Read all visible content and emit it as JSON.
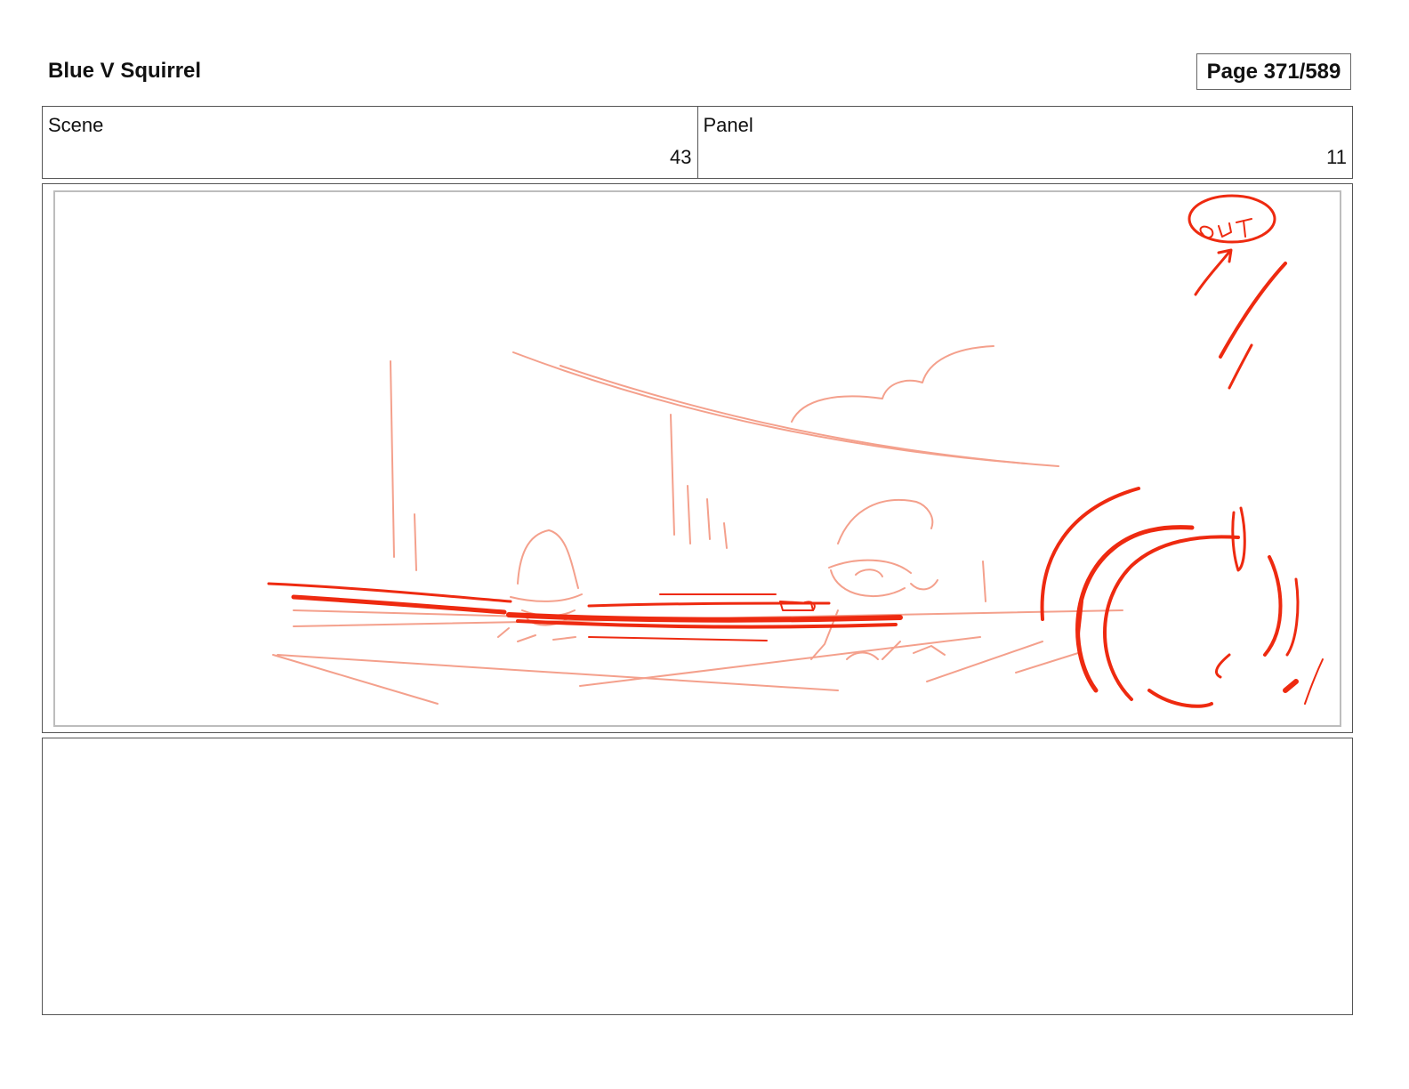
{
  "header": {
    "title": "Blue V Squirrel",
    "page": "Page 371/589"
  },
  "info": {
    "scene_label": "Scene",
    "scene_value": "43",
    "panel_label": "Panel",
    "panel_value": "11"
  },
  "panel": {
    "sketch_text": "OUT",
    "colors": {
      "strong": "#ee2a10",
      "light": "#f4a08c"
    },
    "subject": "sketch-drawing"
  },
  "notes": {
    "text": ""
  }
}
